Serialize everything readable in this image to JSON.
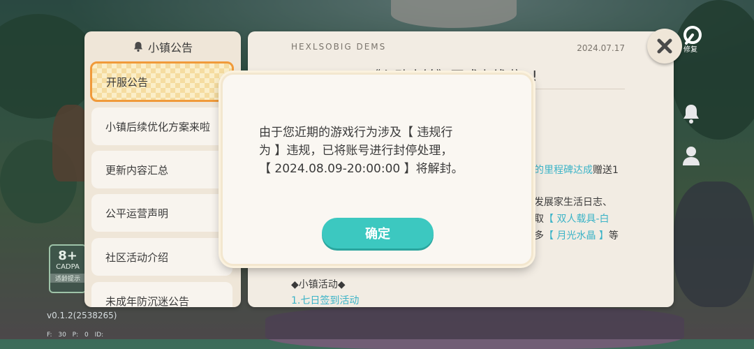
{
  "notice_list": {
    "title": "小镇公告",
    "items": [
      {
        "label": "开服公告",
        "active": true
      },
      {
        "label": "小镇后续优化方案来啦",
        "active": false
      },
      {
        "label": "更新内容汇总",
        "active": false
      },
      {
        "label": "公平运营声明",
        "active": false
      },
      {
        "label": "社区活动介绍",
        "active": false
      },
      {
        "label": "未成年防沉迷公告",
        "active": false
      }
    ]
  },
  "article": {
    "header_script": "HEXLSOBIG DEMS",
    "date": "2024.07.17",
    "headline": "《心动小镇》正式上线啦~!",
    "line1_link": "的里程碑达成",
    "line1_tail": "赠送1",
    "line2": "发展家生活日志、",
    "line3_prefix": "取",
    "line3_highlight": "【 双人载具-白",
    "line4_prefix": "多",
    "line4_highlight": "【 月光水晶 】",
    "line4_tail": "等",
    "section": "◆小镇活动◆",
    "section_item": "1.七日签到活动"
  },
  "side": {
    "repair_label": "修复"
  },
  "age_badge": {
    "age": "8+",
    "org": "CADPA",
    "tip": "适龄提示"
  },
  "version": "v0.1.2(2538265)",
  "stats": "F: 30   P: 0   ID:",
  "modal": {
    "line1": "由于您近期的游戏行为涉及【 违规行",
    "line2": "为 】违规，已将账号进行封停处理，",
    "line3": "【 2024.08.09-20:00:00 】将解封。",
    "confirm_label": "确定"
  },
  "colors": {
    "accent": "#3cc8c0",
    "highlight": "#3bb3c7",
    "active_border": "#f09a3a"
  }
}
